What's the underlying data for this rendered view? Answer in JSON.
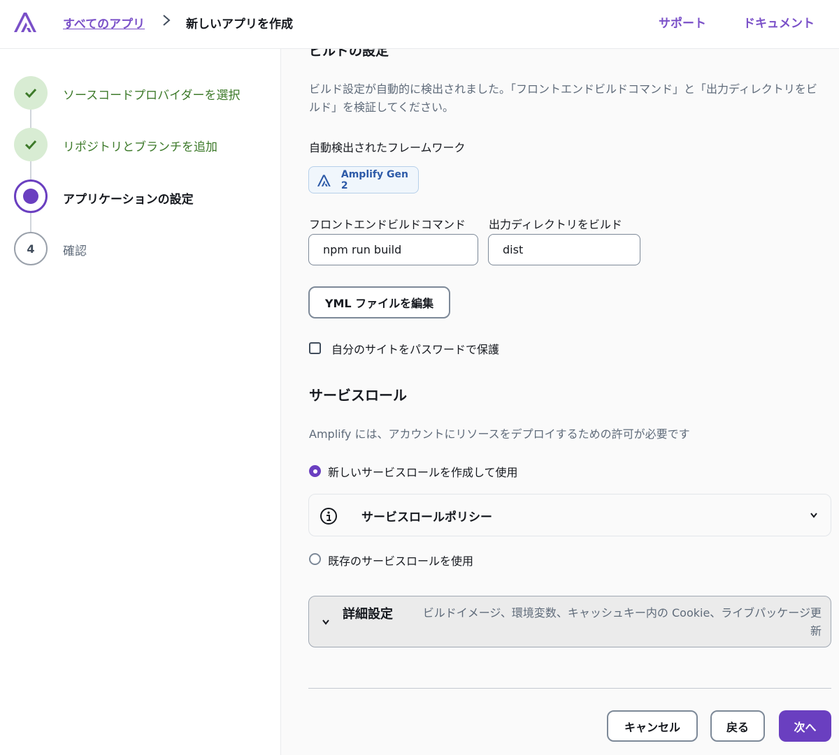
{
  "header": {
    "breadcrumb_link": "すべてのアプリ",
    "breadcrumb_current": "新しいアプリを作成",
    "support_link": "サポート",
    "docs_link": "ドキュメント"
  },
  "steps": [
    {
      "label": "ソースコードプロバイダーを選択",
      "state": "done"
    },
    {
      "label": "リポジトリとブランチを追加",
      "state": "done"
    },
    {
      "label": "アプリケーションの設定",
      "state": "current"
    },
    {
      "label": "確認",
      "state": "todo",
      "number": "4"
    }
  ],
  "build": {
    "section_title": "ビルドの設定",
    "description": "ビルド設定が自動的に検出されました。「フロントエンドビルドコマンド」と「出力ディレクトリをビルド」を検証してください。",
    "framework_label": "自動検出されたフレームワーク",
    "framework_name": "Amplify Gen 2",
    "frontend_cmd_label": "フロントエンドビルドコマンド",
    "frontend_cmd_value": "npm run build",
    "output_dir_label": "出力ディレクトリをビルド",
    "output_dir_value": "dist",
    "edit_yml_button": "YML ファイルを編集",
    "password_protect_label": "自分のサイトをパスワードで保護"
  },
  "service_role": {
    "title": "サービスロール",
    "description": "Amplify には、アカウントにリソースをデプロイするための許可が必要です",
    "option_new": "新しいサービスロールを作成して使用",
    "policy_label": "サービスロールポリシー",
    "option_existing": "既存のサービスロールを使用"
  },
  "advanced": {
    "title": "詳細設定",
    "description": "ビルドイメージ、環境変数、キャッシュキー内の Cookie、ライブパッケージ更新"
  },
  "footer": {
    "cancel": "キャンセル",
    "back": "戻る",
    "next": "次へ"
  },
  "colors": {
    "accent": "#6a3fc0",
    "done_green": "#3d7a2a",
    "done_bg": "#d8ecd3"
  }
}
